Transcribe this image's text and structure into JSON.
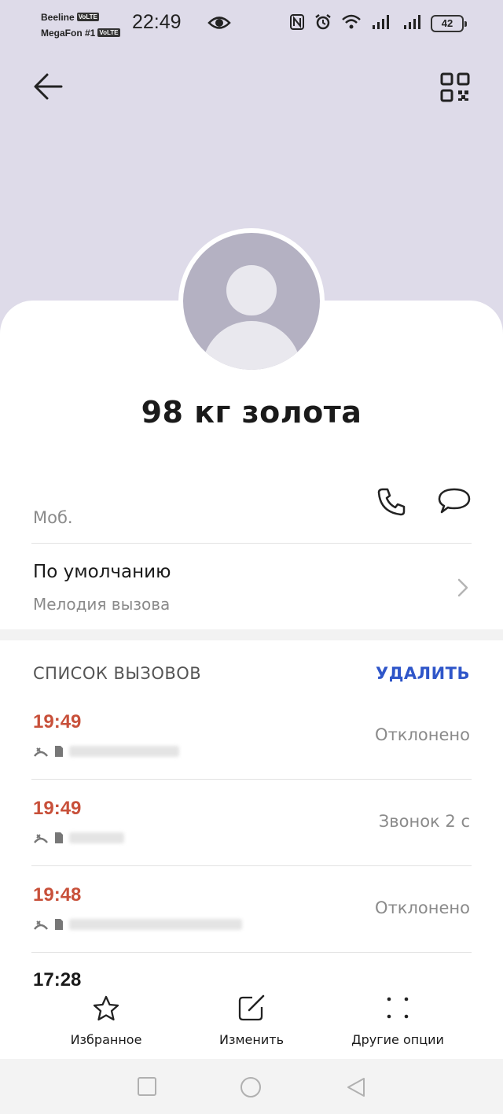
{
  "status_bar": {
    "carrier1": "Beeline",
    "carrier2": "MegaFon #1",
    "volte": "VoLTE",
    "time": "22:49",
    "battery": "42"
  },
  "contact": {
    "name": "98 кг золота",
    "phone_label": "Моб."
  },
  "ringtone": {
    "title": "По умолчанию",
    "subtitle": "Мелодия вызова"
  },
  "call_list": {
    "title": "СПИСОК ВЫЗОВОВ",
    "delete_label": "УДАЛИТЬ",
    "calls": [
      {
        "time": "19:49",
        "status": "Отклонено",
        "missed": true
      },
      {
        "time": "19:49",
        "status": "Звонок 2 с",
        "missed": true
      },
      {
        "time": "19:48",
        "status": "Отклонено",
        "missed": true
      },
      {
        "time": "17:28",
        "status": "",
        "missed": false
      }
    ]
  },
  "bottom_bar": {
    "favorites": "Избранное",
    "edit": "Изменить",
    "more": "Другие опции"
  },
  "colors": {
    "header": "#dedbe9",
    "accent": "#2f56c9",
    "missed": "#c8503a"
  }
}
